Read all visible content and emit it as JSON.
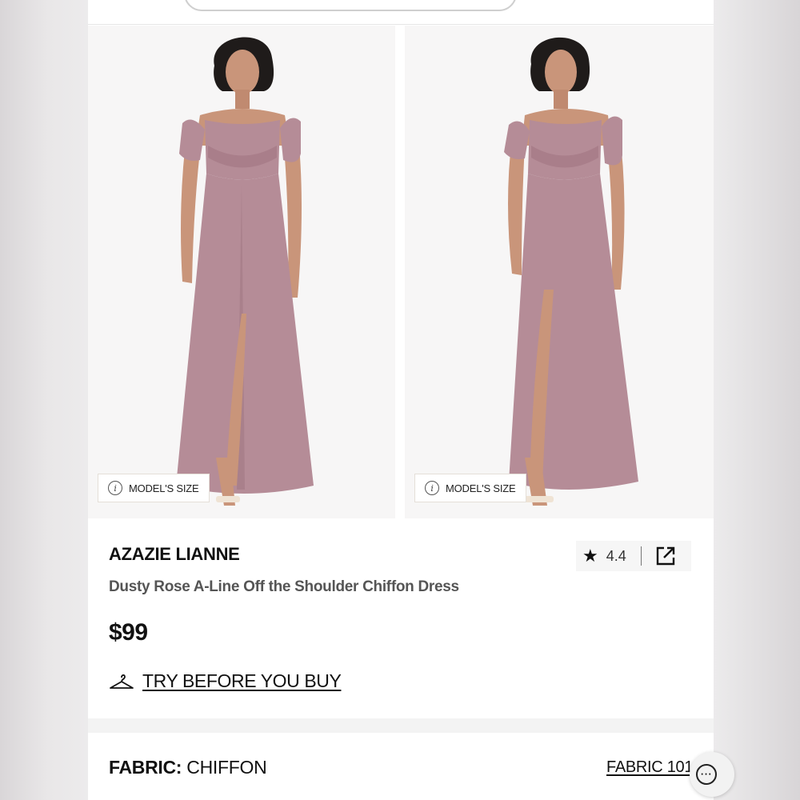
{
  "gallery": {
    "images": [
      {
        "alt": "Model wearing dusty rose off the shoulder chiffon dress, front view",
        "badge": "MODEL'S SIZE"
      },
      {
        "alt": "Model wearing dusty rose off the shoulder chiffon dress, angled view",
        "badge": "MODEL'S SIZE"
      }
    ]
  },
  "product": {
    "brand": "AZAZIE LIANNE",
    "name": "Dusty Rose A-Line Off the Shoulder Chiffon Dress",
    "price": "$99",
    "rating": "4.4",
    "try_label": "TRY BEFORE YOU BUY"
  },
  "fabric": {
    "key": "FABRIC:",
    "value": "CHIFFON",
    "link": "FABRIC 101"
  },
  "icons": {
    "star": "star-icon",
    "share": "external-link-icon",
    "hanger": "hanger-icon",
    "info": "info-icon",
    "chat": "chat-icon"
  },
  "colors": {
    "dress": "#b58c97",
    "dress_shadow": "#9e7380",
    "skin": "#c9957a",
    "hair": "#1f1b1a"
  }
}
